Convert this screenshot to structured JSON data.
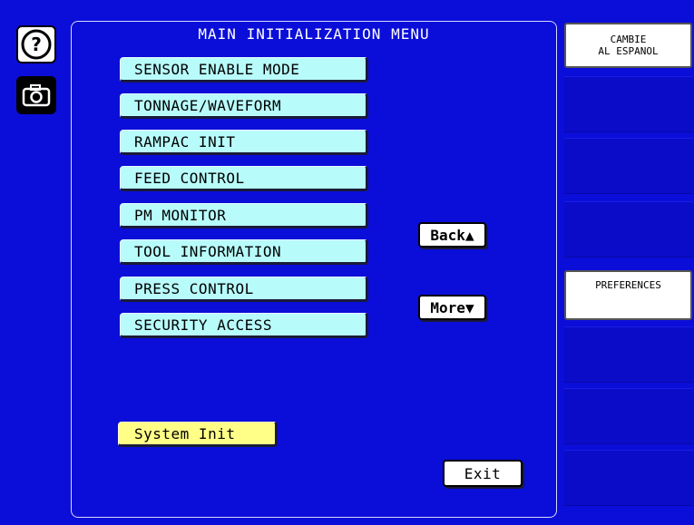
{
  "left_tools": {
    "help_icon": "question-circle",
    "camera_icon": "camera"
  },
  "main": {
    "title": "MAIN INITIALIZATION MENU",
    "menu_items": [
      {
        "label": "SENSOR ENABLE MODE"
      },
      {
        "label": "TONNAGE/WAVEFORM"
      },
      {
        "label": "RAMPAC INIT"
      },
      {
        "label": "FEED CONTROL"
      },
      {
        "label": "PM MONITOR"
      },
      {
        "label": "TOOL INFORMATION"
      },
      {
        "label": "PRESS CONTROL"
      },
      {
        "label": "SECURITY ACCESS"
      }
    ],
    "back_label": "Back▲",
    "more_label": "More▼",
    "system_init_label": "System Init",
    "exit_label": "Exit"
  },
  "right_panel": {
    "top_button_line1": "CAMBIE",
    "top_button_line2": "AL ESPANOL",
    "preferences_label": "PREFERENCES"
  },
  "colors": {
    "background": "#0b0ed8",
    "menu_button": "#b8fbfb",
    "system_init_button": "#ffff88"
  }
}
